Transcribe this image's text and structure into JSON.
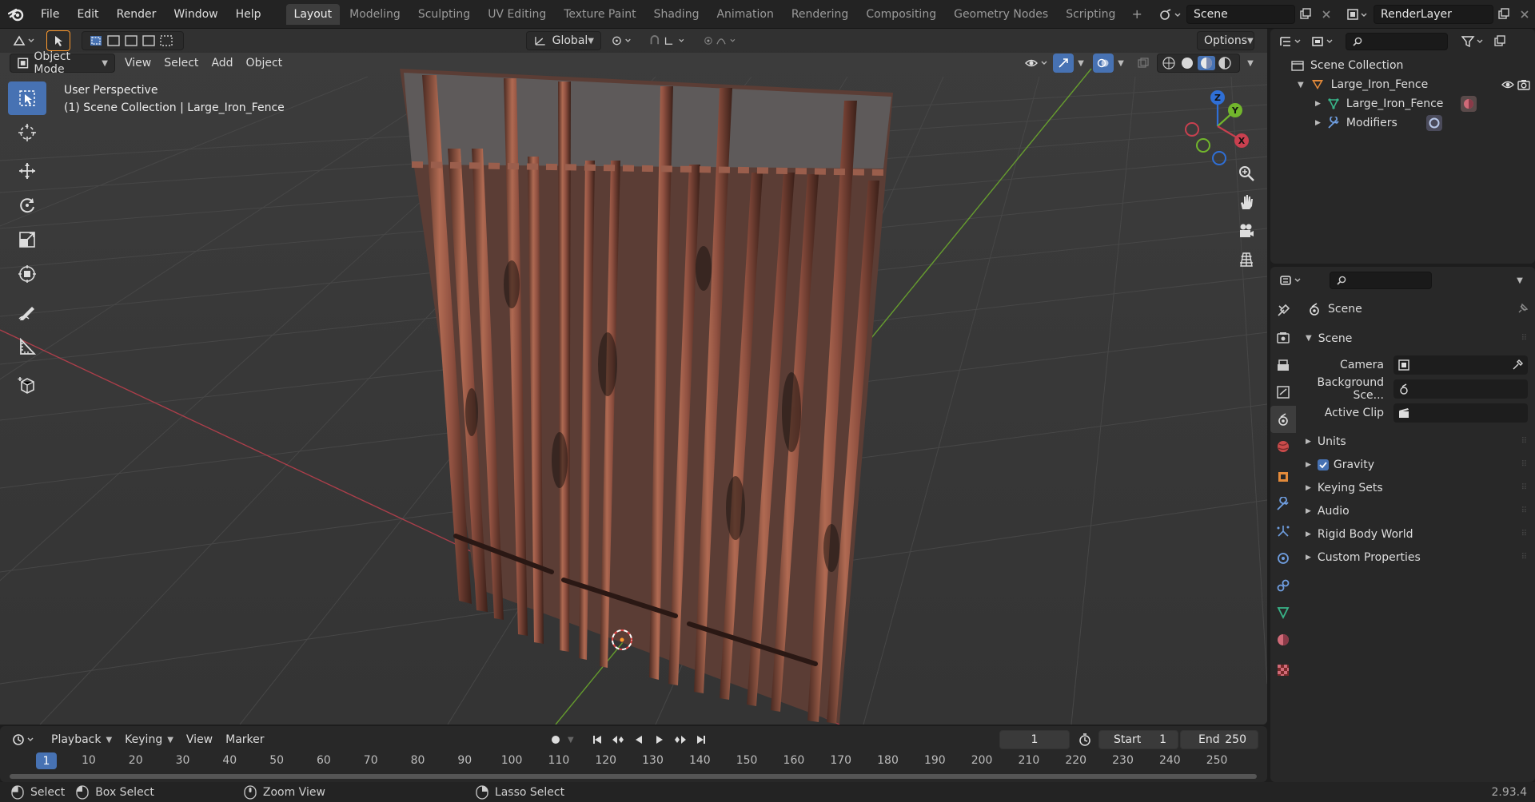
{
  "menu": [
    "File",
    "Edit",
    "Render",
    "Window",
    "Help"
  ],
  "workspaces": [
    "Layout",
    "Modeling",
    "Sculpting",
    "UV Editing",
    "Texture Paint",
    "Shading",
    "Animation",
    "Rendering",
    "Compositing",
    "Geometry Nodes",
    "Scripting"
  ],
  "active_workspace": "Layout",
  "scene_name": "Scene",
  "view_layer": "RenderLayer",
  "viewport": {
    "orientation": "Global",
    "options_label": "Options",
    "mode": "Object Mode",
    "header_menus": [
      "View",
      "Select",
      "Add",
      "Object"
    ],
    "perspective_label": "User Perspective",
    "collection_label": "(1) Scene Collection | Large_Iron_Fence",
    "gizmo_axes": [
      "Z",
      "Y",
      "X"
    ]
  },
  "outliner": {
    "root": "Scene Collection",
    "items": [
      {
        "label": "Large_Iron_Fence"
      },
      {
        "label": "Large_Iron_Fence"
      },
      {
        "label": "Modifiers"
      }
    ]
  },
  "properties": {
    "context_title": "Scene",
    "section": "Scene",
    "fields": [
      {
        "label": "Camera",
        "value": ""
      },
      {
        "label": "Background Sce...",
        "value": ""
      },
      {
        "label": "Active Clip",
        "value": ""
      }
    ],
    "subsections": [
      "Units",
      "Gravity",
      "Keying Sets",
      "Audio",
      "Rigid Body World",
      "Custom Properties"
    ],
    "gravity_enabled": true
  },
  "timeline": {
    "menus": [
      "Playback",
      "Keying",
      "View",
      "Marker"
    ],
    "current_frame": "1",
    "start_label": "Start",
    "start_value": "1",
    "end_label": "End",
    "end_value": "250",
    "ticks": [
      "1",
      "10",
      "20",
      "30",
      "40",
      "50",
      "60",
      "70",
      "80",
      "90",
      "100",
      "110",
      "120",
      "130",
      "140",
      "150",
      "160",
      "170",
      "180",
      "190",
      "200",
      "210",
      "220",
      "230",
      "240",
      "250"
    ]
  },
  "status": {
    "select": "Select",
    "box_select": "Box Select",
    "zoom_view": "Zoom View",
    "lasso_select": "Lasso Select",
    "version": "2.93.4"
  },
  "colors": {
    "accent": "#4772b3",
    "x_axis": "#c9404f",
    "y_axis": "#72b62c",
    "z_axis": "#2f6fd6",
    "fence": "#8a4a38"
  }
}
